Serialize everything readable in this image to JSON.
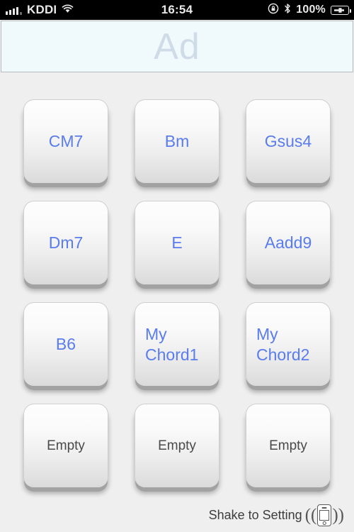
{
  "status_bar": {
    "carrier": "KDDI",
    "time": "16:54",
    "battery_percent": "100%",
    "signal_bars_filled": 4,
    "signal_bars_total": 5,
    "icons": [
      "signal-bars-icon",
      "wifi-icon",
      "rotation-lock-icon",
      "bluetooth-icon",
      "battery-charging-icon"
    ]
  },
  "ad_banner": {
    "label": "Ad",
    "background_color": "#f0f9fc",
    "text_color": "#cfdce8",
    "border_color": "#b9bcbe"
  },
  "chord_grid": {
    "columns": 3,
    "rows": 4,
    "chord_text_color": "#5a7ced",
    "empty_text_color": "#4a4a4a",
    "buttons": [
      {
        "label": "CM7",
        "state": "filled",
        "wrap": false
      },
      {
        "label": "Bm",
        "state": "filled",
        "wrap": false
      },
      {
        "label": "Gsus4",
        "state": "filled",
        "wrap": false
      },
      {
        "label": "Dm7",
        "state": "filled",
        "wrap": false
      },
      {
        "label": "E",
        "state": "filled",
        "wrap": false
      },
      {
        "label": "Aadd9",
        "state": "filled",
        "wrap": false
      },
      {
        "label": "B6",
        "state": "filled",
        "wrap": false
      },
      {
        "label": "My Chord1",
        "state": "filled",
        "wrap": true
      },
      {
        "label": "My Chord2",
        "state": "filled",
        "wrap": true
      },
      {
        "label": "Empty",
        "state": "empty",
        "wrap": false
      },
      {
        "label": "Empty",
        "state": "empty",
        "wrap": false
      },
      {
        "label": "Empty",
        "state": "empty",
        "wrap": false
      }
    ]
  },
  "footer": {
    "hint_text": "Shake to Setting",
    "icon": "shaking-phone-icon",
    "wave_left": "((",
    "wave_right": "))"
  },
  "theme": {
    "page_background": "#efefef",
    "button_face_top": "#fdfdfd",
    "button_face_bottom": "#dadada",
    "button_lip": "#a2a2a2"
  }
}
